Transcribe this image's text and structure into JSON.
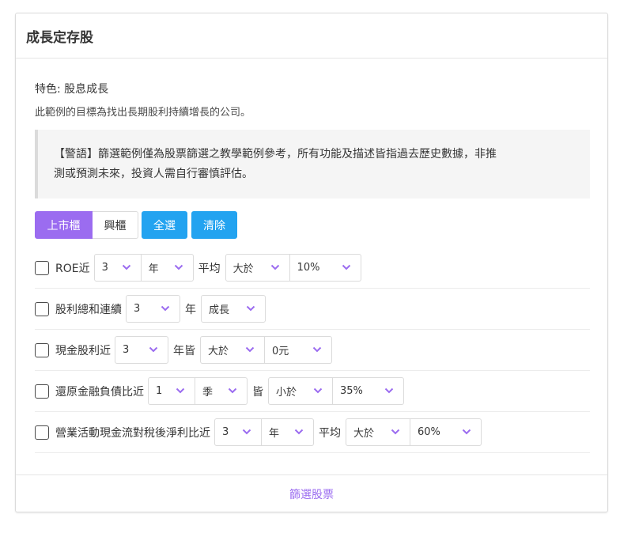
{
  "card": {
    "title": "成長定存股",
    "feature": "特色: 股息成長",
    "description": "此範例的目標為找出長期股利持續增長的公司。",
    "warning_line1": "【警語】篩選範例僅為股票篩選之教學範例參考，所有功能及描述皆指過去歷史數據，非推",
    "warning_line2": "測或預測未來，投資人需自行審慎評估。"
  },
  "buttons": {
    "listed": "上市櫃",
    "emerging": "興櫃",
    "select_all": "全選",
    "clear": "清除"
  },
  "conditions": [
    {
      "label": "ROE近",
      "sel1": "3",
      "sel2": "年",
      "mid": "平均",
      "sel3": "大於",
      "sel4": "10%"
    },
    {
      "label": "股利總和連續",
      "sel1": "3",
      "mid": "年",
      "sel3": "成長"
    },
    {
      "label": "現金股利近",
      "sel1": "3",
      "mid": "年皆",
      "sel3": "大於",
      "sel4": "0元"
    },
    {
      "label": "還原金融負債比近",
      "sel1": "1",
      "sel2": "季",
      "mid": "皆",
      "sel3": "小於",
      "sel4": "35%"
    },
    {
      "label": "營業活動現金流對稅後淨利比近",
      "sel1": "3",
      "sel2": "年",
      "mid": "平均",
      "sel3": "大於",
      "sel4": "60%"
    }
  ],
  "footer": {
    "submit": "篩選股票"
  },
  "colors": {
    "accent": "#9b6cf0",
    "info": "#23a3f0"
  }
}
